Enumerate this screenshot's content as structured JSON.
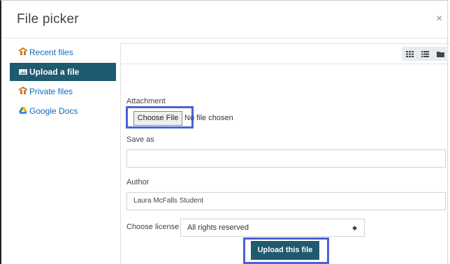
{
  "dialog": {
    "title": "File picker",
    "close_glyph": "×"
  },
  "sidebar": {
    "items": [
      {
        "label": "Recent files",
        "icon": "recent-files-icon",
        "active": false
      },
      {
        "label": "Upload a file",
        "icon": "upload-icon",
        "active": true
      },
      {
        "label": "Private files",
        "icon": "private-files-icon",
        "active": false
      },
      {
        "label": "Google Docs",
        "icon": "google-drive-icon",
        "active": false
      }
    ]
  },
  "toolbar": {
    "view_buttons": [
      "icons-view-icon",
      "list-view-icon",
      "folder-view-icon"
    ]
  },
  "form": {
    "attachment_label": "Attachment",
    "choose_file_label": "Choose File",
    "no_file_text": "No file chosen",
    "save_as_label": "Save as",
    "save_as_value": "",
    "author_label": "Author",
    "author_value": "Laura McFalls Student",
    "license_label": "Choose license",
    "license_selected": "All rights reserved",
    "upload_button_label": "Upload this file"
  },
  "colors": {
    "active_bg": "#1e5a70",
    "link": "#0f6cbf",
    "highlight_border": "#4c61d8"
  }
}
